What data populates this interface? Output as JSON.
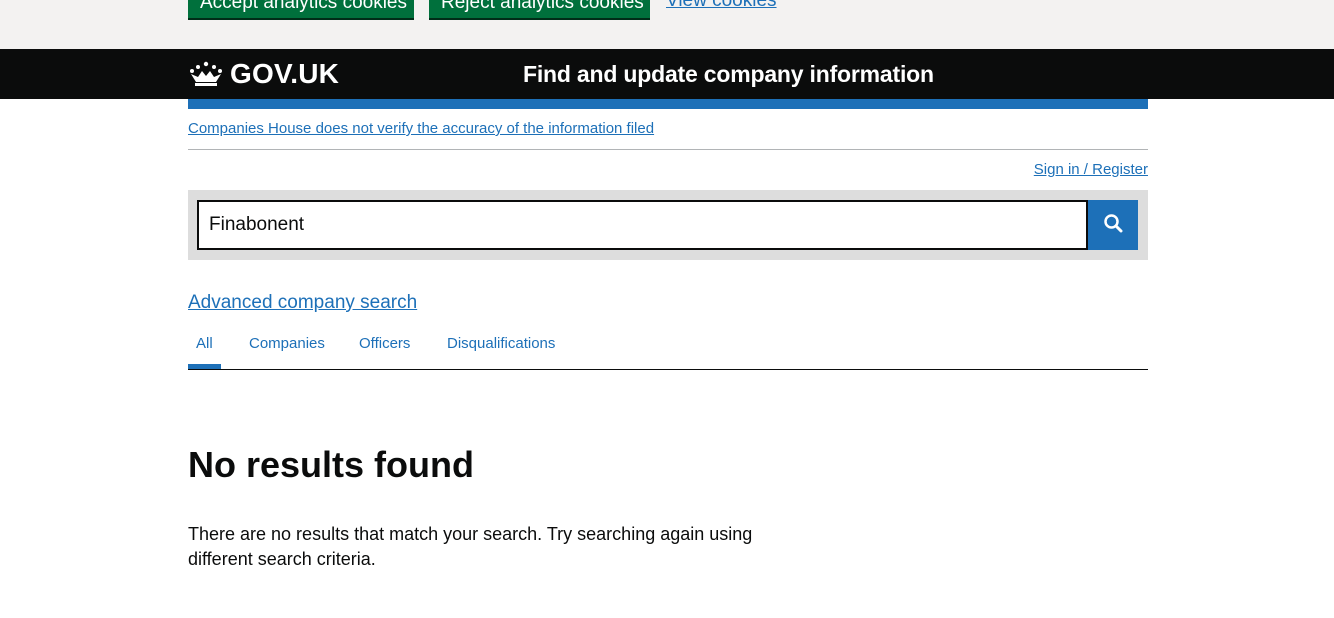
{
  "cookie_banner": {
    "accept_label": "Accept analytics cookies",
    "reject_label": "Reject analytics cookies",
    "view_label": "View cookies"
  },
  "header": {
    "logo_text": "GOV.UK",
    "service_name": "Find and update company information"
  },
  "disclaimer": "Companies House does not verify the accuracy of the information filed",
  "signin_label": "Sign in / Register",
  "search": {
    "value": "Finabonent",
    "button_icon": "search-icon"
  },
  "advanced_search_label": "Advanced company search",
  "tabs": [
    {
      "label": "All",
      "active": true
    },
    {
      "label": "Companies",
      "active": false
    },
    {
      "label": "Officers",
      "active": false
    },
    {
      "label": "Disqualifications",
      "active": false
    }
  ],
  "results": {
    "heading": "No results found",
    "message": "There are no results that match your search. Try searching again using different search criteria."
  },
  "colors": {
    "link": "#1d70b8",
    "header_bg": "#0b0c0c",
    "button_green": "#00703c",
    "search_bg": "#dddddd"
  }
}
